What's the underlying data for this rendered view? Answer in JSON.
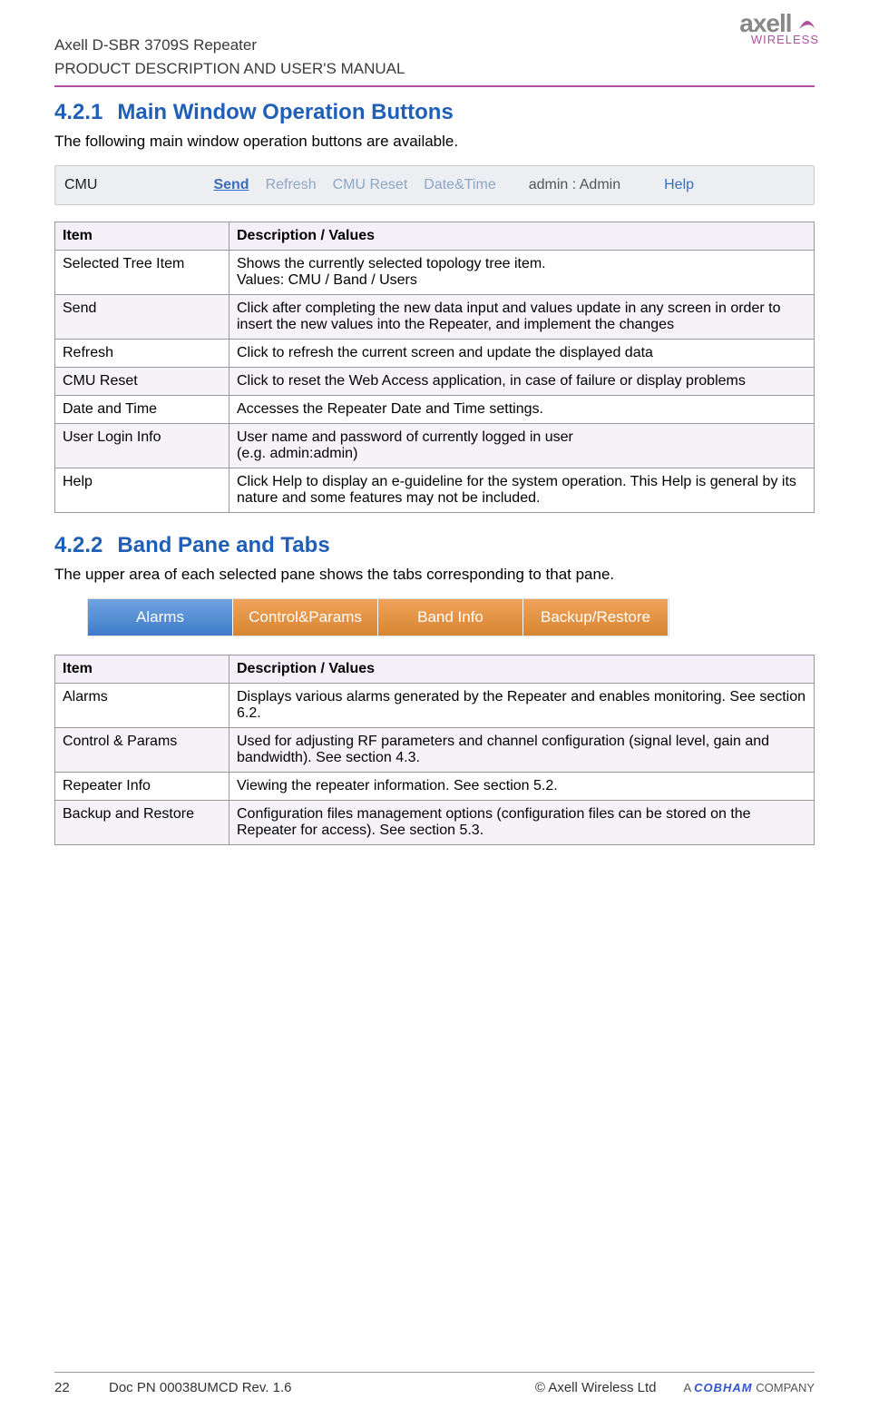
{
  "header": {
    "title": "Axell D-SBR 3709S Repeater",
    "subtitle": "PRODUCT DESCRIPTION AND USER'S MANUAL",
    "logo_main": "axell",
    "logo_sub": "WIRELESS"
  },
  "sec1": {
    "num": "4.2.1",
    "title": "Main Window Operation Buttons",
    "intro": "The following main window operation buttons are available."
  },
  "toolbar": {
    "cmu": "CMU",
    "send": "Send",
    "refresh": "Refresh",
    "reset": "CMU Reset",
    "dt": "Date&Time",
    "admin": "admin : Admin",
    "help": "Help"
  },
  "table1": {
    "h1": "Item",
    "h2": "Description / Values",
    "rows": [
      {
        "a": "Selected Tree Item",
        "b": "Shows the currently selected topology tree item.",
        "b2": "Values: CMU / Band / Users"
      },
      {
        "a": "Send",
        "b": "Click after completing the new data input and values update in any screen in order to insert the new values into the Repeater, and implement the changes"
      },
      {
        "a": "Refresh",
        "b": "Click to refresh the current screen and update the displayed data"
      },
      {
        "a": "CMU Reset",
        "b": "Click to reset the Web Access application, in case of failure or display problems"
      },
      {
        "a": "Date and Time",
        "b": "Accesses the Repeater Date and Time settings."
      },
      {
        "a": "User Login Info",
        "b": "User name and password of currently logged in user",
        "b2": " (e.g. admin:admin)"
      },
      {
        "a": "Help",
        "b": "Click Help to display an e-guideline for the system operation.  This Help is general by its nature and some features may not be included."
      }
    ]
  },
  "sec2": {
    "num": "4.2.2",
    "title": "Band Pane and Tabs",
    "intro": "The upper area of each selected pane shows the tabs corresponding to that pane."
  },
  "tabs": {
    "t1": "Alarms",
    "t2": "Control&Params",
    "t3": "Band Info",
    "t4": "Backup/Restore"
  },
  "table2": {
    "h1": "Item",
    "h2": "Description / Values",
    "rows": [
      {
        "a": "Alarms",
        "b": "Displays various alarms generated by the Repeater and enables monitoring. See section 6.2."
      },
      {
        "a": "Control & Params",
        "b": "Used for adjusting RF parameters and channel configuration (signal level, gain and bandwidth). See section 4.3."
      },
      {
        "a": "Repeater Info",
        "b": "Viewing the repeater information. See section 5.2."
      },
      {
        "a": "Backup and Restore",
        "b": "Configuration files management options (configuration files can be stored on the Repeater for access). See section 5.3."
      }
    ]
  },
  "footer": {
    "page": "22",
    "doc": "Doc PN 00038UMCD Rev. 1.6",
    "copy": "© Axell Wireless Ltd",
    "a": "A",
    "cob": "COBHAM",
    "comp": "COMPANY"
  }
}
